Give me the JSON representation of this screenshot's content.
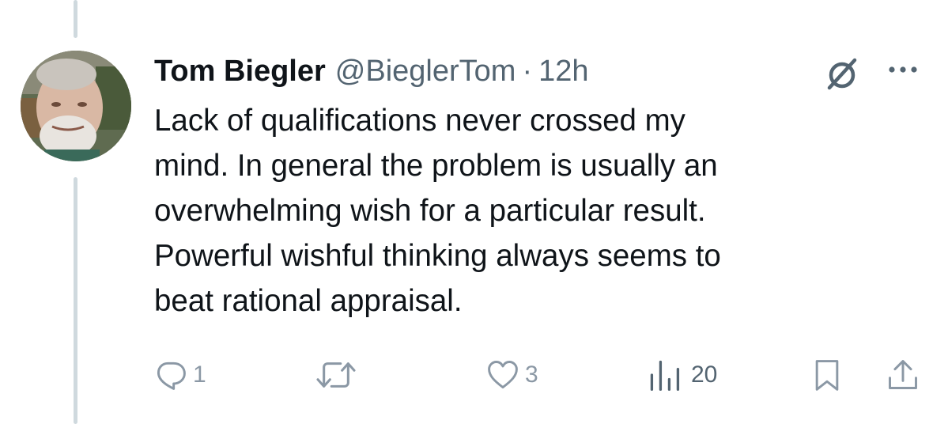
{
  "tweet": {
    "display_name": "Tom Biegler",
    "handle": "@BieglerTom",
    "separator": "·",
    "time": "12h",
    "text_lines": [
      "Lack of qualifications never crossed my",
      "mind. In general the problem is usually an",
      "overwhelming wish for a particular result.",
      "Powerful wishful thinking always seems to",
      "beat rational appraisal."
    ]
  },
  "actions": {
    "replies": "1",
    "retweets": "",
    "likes": "3",
    "views": "20"
  },
  "icons": {
    "avatar": "avatar",
    "grok": "grok-icon",
    "more": "more-dots-icon",
    "reply": "reply-icon",
    "retweet": "retweet-icon",
    "like": "heart-icon",
    "views": "views-chart-icon",
    "bookmark": "bookmark-icon",
    "share": "share-icon"
  },
  "colors": {
    "text_primary": "#0f1419",
    "text_secondary": "#536471",
    "action_faded": "#8b98a5",
    "thread_line": "#cfd9de",
    "background": "#ffffff"
  }
}
